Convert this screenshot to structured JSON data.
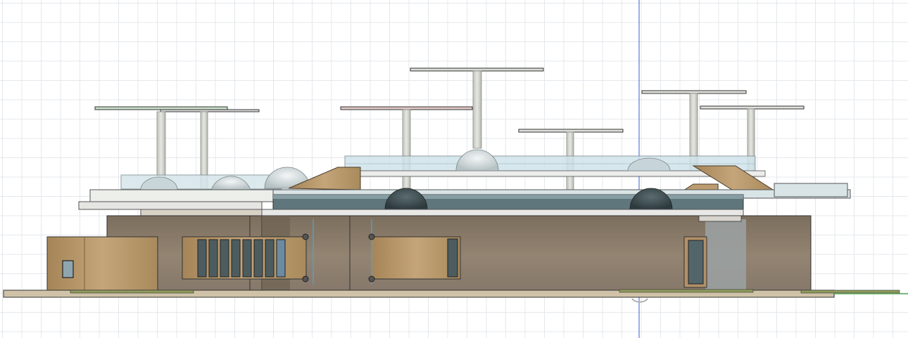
{
  "viewport": {
    "background": "#ffffff",
    "grid_color": "#e4e8ec",
    "axis_color": "#3b5bdb",
    "ground_line_color": "#59a659"
  },
  "model": {
    "walls": "#8a7a66",
    "wood": "#b59468",
    "glass": "#c7dde5",
    "dark_glass": "#3d4f55",
    "slab": "#e7e8e4",
    "roof_edge": "#555555"
  },
  "icons": [
    "axis-marker-icon",
    "joint-handle-icon"
  ]
}
